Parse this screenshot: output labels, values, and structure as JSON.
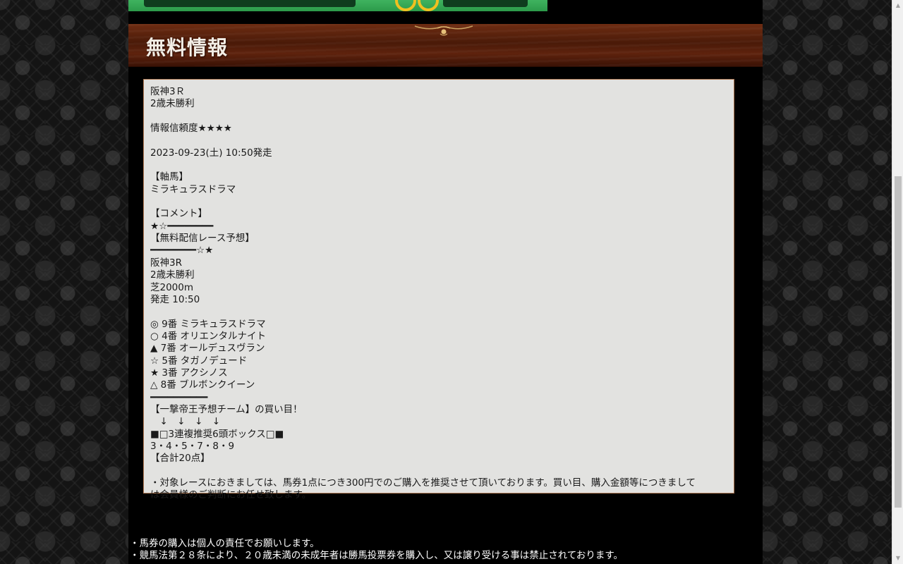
{
  "section": {
    "title": "無料情報"
  },
  "info_box": {
    "lines": [
      "阪神3Ｒ",
      "2歳未勝利",
      "",
      "情報信頼度★★★★",
      "",
      "2023-09-23(土) 10:50発走",
      "",
      "【軸馬】",
      "ミラキュラスドラマ",
      "",
      "【コメント】",
      "★☆━━━━━━━━",
      "【無料配信レース予想】",
      "━━━━━━━━☆★",
      "阪神3R",
      "2歳未勝利",
      "芝2000m",
      "発走 10:50",
      "",
      "◎ 9番 ミラキュラスドラマ",
      "○ 4番 オリエンタルナイト",
      "▲ 7番 オールデュスヴラン",
      "☆ 5番 タガノデュード",
      "★ 3番 アクシノス",
      "△ 8番 ブルボンクイーン",
      "━━━━━━━━━━",
      "【一撃帝王予想チーム】の買い目！",
      "　↓　↓　↓　↓",
      "■□3連複推奨6頭ボックス□■",
      "3・4・5・7・8・9",
      "【合計20点】",
      "",
      "・対象レースにおきましては、馬券1点につき300円でのご購入を推奨させて頂いております。買い目、購入金額等につきまして",
      "は会員様のご判断にお任せ致します。"
    ]
  },
  "footer": {
    "notes": [
      "・馬券の購入は個人の責任でお願いします。",
      "・競馬法第２８条により、２０歳未満の未成年者は勝馬投票券を購入し、又は譲り受ける事は禁止されております。"
    ]
  },
  "colors": {
    "header_brown": "#5e220d",
    "box_background": "#e2e2e0",
    "banner_green": "#3fb35f"
  }
}
